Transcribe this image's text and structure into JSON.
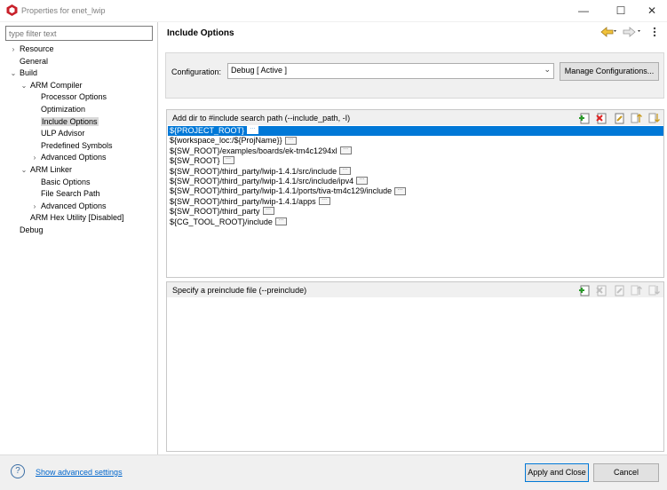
{
  "window": {
    "title": "Properties for enet_lwip",
    "minimize": "—",
    "maximize": "☐",
    "close": "✕"
  },
  "filter": {
    "placeholder": "type filter text"
  },
  "tree": [
    {
      "label": "Resource",
      "twisty": "›"
    },
    {
      "label": "General",
      "twisty": ""
    },
    {
      "label": "Build",
      "twisty": "⌄"
    },
    {
      "label": "ARM Compiler",
      "twisty": "⌄"
    },
    {
      "label": "Processor Options",
      "twisty": ""
    },
    {
      "label": "Optimization",
      "twisty": ""
    },
    {
      "label": "Include Options",
      "twisty": "",
      "selected": true
    },
    {
      "label": "ULP Advisor",
      "twisty": ""
    },
    {
      "label": "Predefined Symbols",
      "twisty": ""
    },
    {
      "label": "Advanced Options",
      "twisty": "›"
    },
    {
      "label": "ARM Linker",
      "twisty": "⌄"
    },
    {
      "label": "Basic Options",
      "twisty": ""
    },
    {
      "label": "File Search Path",
      "twisty": ""
    },
    {
      "label": "Advanced Options",
      "twisty": "›"
    },
    {
      "label": "ARM Hex Utility  [Disabled]",
      "twisty": ""
    },
    {
      "label": "Debug",
      "twisty": ""
    }
  ],
  "header": {
    "title": "Include Options"
  },
  "config": {
    "label": "Configuration:",
    "value": "Debug  [ Active ]",
    "manage_label": "Manage Configurations..."
  },
  "include_paths": {
    "label": "Add dir to #include search path (--include_path, -I)",
    "items": [
      "${PROJECT_ROOT}",
      "${workspace_loc:/${ProjName}}",
      "${SW_ROOT}/examples/boards/ek-tm4c1294xl",
      "${SW_ROOT}",
      "${SW_ROOT}/third_party/lwip-1.4.1/src/include",
      "${SW_ROOT}/third_party/lwip-1.4.1/src/include/ipv4",
      "${SW_ROOT}/third_party/lwip-1.4.1/ports/tiva-tm4c129/include",
      "${SW_ROOT}/third_party/lwip-1.4.1/apps",
      "${SW_ROOT}/third_party",
      "${CG_TOOL_ROOT}/include"
    ]
  },
  "preinclude": {
    "label": "Specify a preinclude file (--preinclude)"
  },
  "footer": {
    "help_icon": "?",
    "advanced_link": "Show advanced settings",
    "apply_label": "Apply and Close",
    "cancel_label": "Cancel"
  },
  "colors": {
    "selection": "#0078d7",
    "link": "#0066cc"
  }
}
